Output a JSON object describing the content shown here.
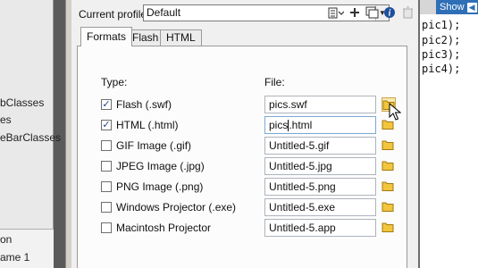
{
  "left_panel": {
    "items": [
      "bClasses",
      "es",
      "eBarClasses"
    ],
    "bottom_items": [
      "on",
      "ame 1"
    ]
  },
  "code_panel": {
    "show_label": "Show",
    "lines": [
      "pic1);",
      "pic2);",
      "pic3);",
      "pic4);"
    ]
  },
  "dialog": {
    "profile_label": "Current profile:",
    "profile_value": "Default",
    "toolbar_icons": [
      "import-export-icon",
      "add-profile-icon",
      "duplicate-profile-icon",
      "profile-info-icon",
      "delete-profile-icon"
    ],
    "tabs": [
      "Formats",
      "Flash",
      "HTML"
    ],
    "active_tab": "Formats",
    "col_type": "Type:",
    "col_file": "File:",
    "rows": [
      {
        "label": "Flash  (.swf)",
        "checked": true,
        "file": "pics.swf"
      },
      {
        "label": "HTML  (.html)",
        "checked": true,
        "file_before_caret": "pics",
        "file_after_caret": ".html"
      },
      {
        "label": "GIF Image  (.gif)",
        "checked": false,
        "file": "Untitled-5.gif"
      },
      {
        "label": "JPEG Image  (.jpg)",
        "checked": false,
        "file": "Untitled-5.jpg"
      },
      {
        "label": "PNG Image  (.png)",
        "checked": false,
        "file": "Untitled-5.png"
      },
      {
        "label": "Windows Projector  (.exe)",
        "checked": false,
        "file": "Untitled-5.exe"
      },
      {
        "label": "Macintosh Projector",
        "checked": false,
        "file": "Untitled-5.app"
      }
    ],
    "check_mark": "✓"
  },
  "colors": {
    "folder_yellow": "#f2c53d",
    "folder_outline": "#a37a12",
    "show_blue": "#2f6fb7"
  }
}
